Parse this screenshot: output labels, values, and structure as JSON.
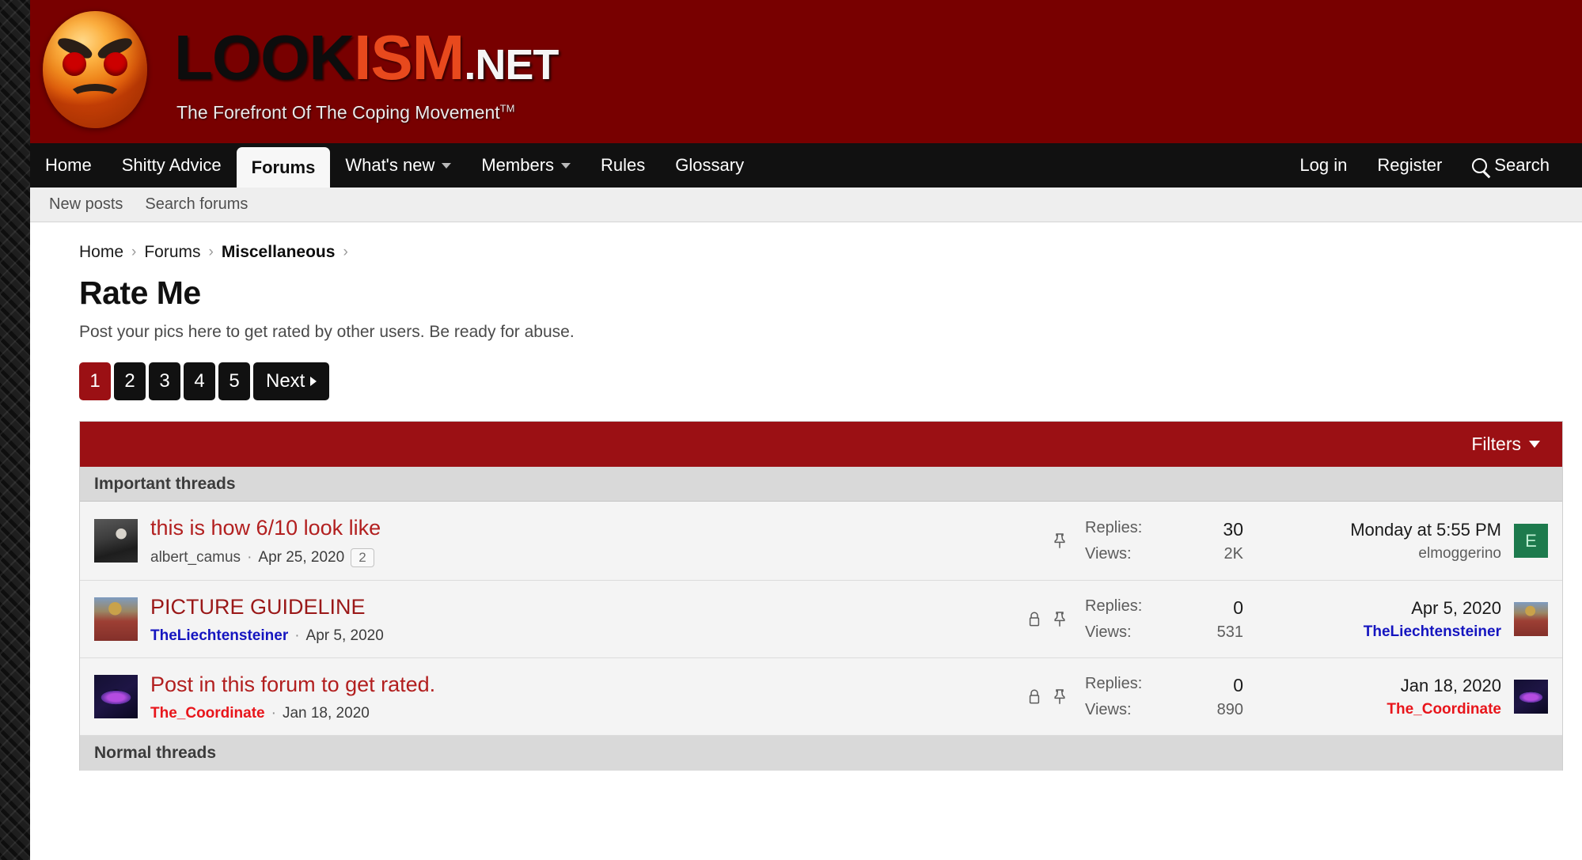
{
  "site": {
    "logo_text_primary": "LOOK",
    "logo_text_accent": "ISM",
    "logo_text_suffix": ".NET",
    "tagline": "The Forefront Of The Coping Movement",
    "trademark": "TM",
    "header_color": "#780000",
    "accent_color": "#9b1014"
  },
  "nav": {
    "items": [
      {
        "label": "Home",
        "has_caret": false,
        "active": false
      },
      {
        "label": "Shitty Advice",
        "has_caret": false,
        "active": false
      },
      {
        "label": "Forums",
        "has_caret": false,
        "active": true
      },
      {
        "label": "What's new",
        "has_caret": true,
        "active": false
      },
      {
        "label": "Members",
        "has_caret": true,
        "active": false
      },
      {
        "label": "Rules",
        "has_caret": false,
        "active": false
      },
      {
        "label": "Glossary",
        "has_caret": false,
        "active": false
      }
    ],
    "right_items": [
      {
        "label": "Log in"
      },
      {
        "label": "Register"
      },
      {
        "label": "Search"
      }
    ]
  },
  "subnav": {
    "items": [
      {
        "label": "New posts"
      },
      {
        "label": "Search forums"
      }
    ]
  },
  "breadcrumb": {
    "items": [
      {
        "label": "Home",
        "current": false
      },
      {
        "label": "Forums",
        "current": false
      },
      {
        "label": "Miscellaneous",
        "current": true
      }
    ],
    "separator": "›"
  },
  "page": {
    "title": "Rate Me",
    "description": "Post your pics here to get rated by other users. Be ready for abuse."
  },
  "pagination": {
    "pages": [
      "1",
      "2",
      "3",
      "4",
      "5"
    ],
    "active_page": "1",
    "next_label": "Next"
  },
  "toolbar": {
    "filters_label": "Filters"
  },
  "sections": {
    "important_label": "Important threads",
    "normal_label": "Normal threads"
  },
  "labels": {
    "replies": "Replies:",
    "views": "Views:"
  },
  "threads": [
    {
      "title": "this is how 6/10 look like",
      "title_style": "red",
      "author": "albert_camus",
      "author_style": "plain",
      "date": "Apr 25, 2020",
      "page_chip": "2",
      "locked": false,
      "pinned": true,
      "replies": "30",
      "views": "2K",
      "last_date": "Monday at 5:55 PM",
      "last_user": "elmoggerino",
      "last_user_style": "gray",
      "last_avatar_letter": "E",
      "avatar_class": "av-camus",
      "last_avatar_class": "av-letter-e"
    },
    {
      "title": "PICTURE GUIDELINE",
      "title_style": "darkred",
      "author": "TheLiechtensteiner",
      "author_style": "blue",
      "date": "Apr 5, 2020",
      "page_chip": "",
      "locked": true,
      "pinned": true,
      "replies": "0",
      "views": "531",
      "last_date": "Apr 5, 2020",
      "last_user": "TheLiechtensteiner",
      "last_user_style": "blue",
      "last_avatar_letter": "",
      "avatar_class": "av-liecht",
      "last_avatar_class": "av-liecht"
    },
    {
      "title": "Post in this forum to get rated.",
      "title_style": "red",
      "author": "The_Coordinate",
      "author_style": "red",
      "date": "Jan 18, 2020",
      "page_chip": "",
      "locked": true,
      "pinned": true,
      "replies": "0",
      "views": "890",
      "last_date": "Jan 18, 2020",
      "last_user": "The_Coordinate",
      "last_user_style": "red",
      "last_avatar_letter": "",
      "avatar_class": "av-coord",
      "last_avatar_class": "av-coord"
    }
  ]
}
